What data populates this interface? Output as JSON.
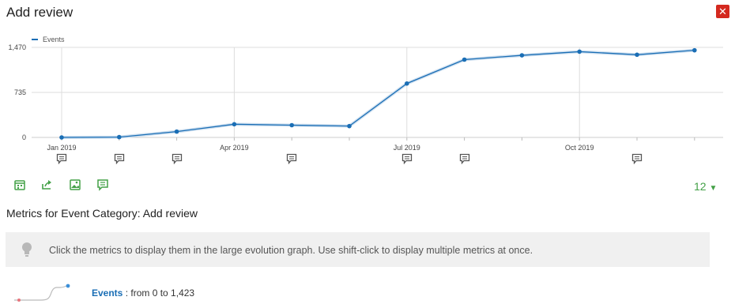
{
  "header": {
    "title": "Add review",
    "close_label": "✕"
  },
  "chart_data": {
    "type": "line",
    "legend": "Events",
    "x_ticks": [
      "Jan 2019",
      "Apr 2019",
      "Jul 2019",
      "Oct 2019"
    ],
    "y_ticks": [
      "1,470",
      "735",
      "0"
    ],
    "ylim": [
      0,
      1470
    ],
    "series": [
      {
        "name": "Events",
        "x": [
          "Jan 2019",
          "Feb 2019",
          "Mar 2019",
          "Apr 2019",
          "May 2019",
          "Jun 2019",
          "Jul 2019",
          "Aug 2019",
          "Sep 2019",
          "Oct 2019",
          "Nov 2019",
          "Dec 2019"
        ],
        "values": [
          0,
          5,
          95,
          215,
          200,
          185,
          880,
          1270,
          1340,
          1400,
          1350,
          1423
        ]
      }
    ],
    "annotations_at": [
      "Jan 2019",
      "Feb 2019",
      "Mar 2019",
      "May 2019",
      "Jul 2019",
      "Aug 2019",
      "Nov 2019"
    ],
    "line_color": "#1a6eb5",
    "grid": true,
    "legend_position": "top-left"
  },
  "toolbar": {
    "icons": [
      "calendar-icon",
      "export-icon",
      "image-icon",
      "annotation-icon"
    ],
    "period_value": "12"
  },
  "metrics": {
    "title": "Metrics for Event Category: Add review",
    "info_text": "Click the metrics to display them in the large evolution graph. Use shift-click to display multiple metrics at once.",
    "rows": [
      {
        "name": "Events",
        "range": ": from 0 to 1,423"
      }
    ]
  },
  "colors": {
    "accent": "#43a047",
    "close": "#d4291f",
    "series": "#1a6eb5"
  }
}
